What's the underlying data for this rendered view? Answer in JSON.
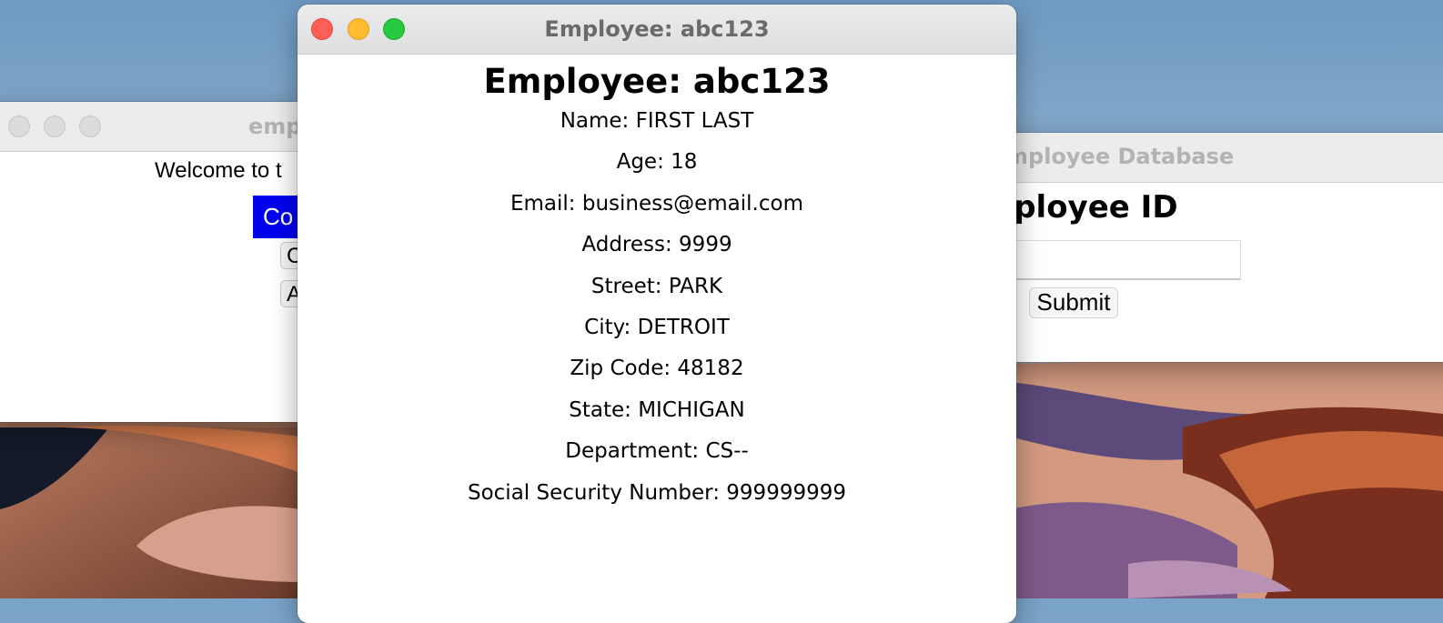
{
  "left_window": {
    "title": "emp",
    "welcome": "Welcome to t",
    "btn1": "Co",
    "btn2": "C",
    "btn3": "A"
  },
  "right_window": {
    "title": "mployee Database",
    "heading": "nployee ID",
    "submit": "Submit"
  },
  "main_window": {
    "title": "Employee: abc123",
    "heading": "Employee: abc123",
    "fields": [
      "Name: FIRST LAST",
      "Age: 18",
      "Email: business@email.com",
      "Address: 9999",
      "Street: PARK",
      "City: DETROIT",
      "Zip Code: 48182",
      "State: MICHIGAN",
      "Department: CS--",
      "Social Security Number: 999999999"
    ]
  },
  "colors": {
    "close": "#fe5f57",
    "minimize": "#febc2e",
    "zoom": "#28c840",
    "accent_button": "#0000ee"
  },
  "icons": [
    "close-icon",
    "minimize-icon",
    "zoom-icon"
  ]
}
